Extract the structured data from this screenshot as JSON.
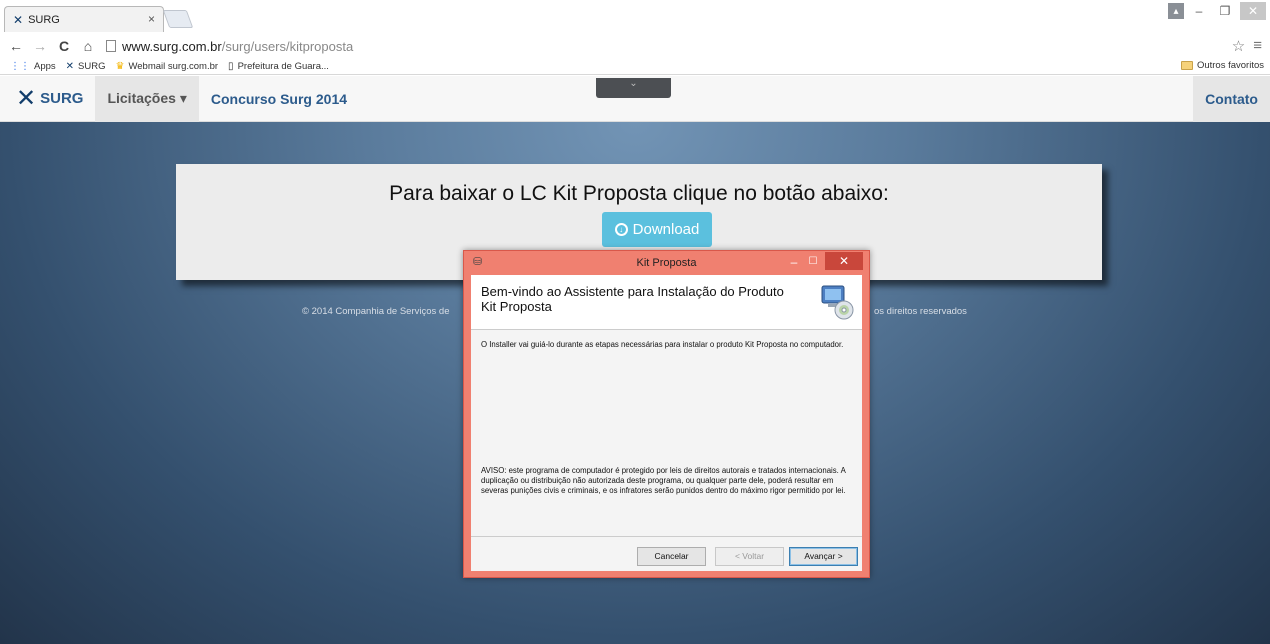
{
  "browser": {
    "tab_title": "SURG",
    "tab_close": "×",
    "url_host": "www.surg.com.br",
    "url_path": "/surg/users/kitproposta",
    "bookmarks": [
      {
        "label": "Apps"
      },
      {
        "label": "SURG"
      },
      {
        "label": "Webmail surg.com.br"
      },
      {
        "label": "Prefeitura de Guara..."
      }
    ],
    "other_bookmarks": "Outros favoritos"
  },
  "site": {
    "brand": "SURG",
    "nav_licitacoes": "Licitações ▾",
    "nav_concurso": "Concurso Surg 2014",
    "nav_contato": "Contato"
  },
  "main": {
    "heading": "Para baixar o LC Kit Proposta clique no botão abaixo:",
    "download_label": "Download",
    "footer_left": "© 2014 Companhia de Serviços de",
    "footer_right": "os direitos reservados"
  },
  "dialog": {
    "title": "Kit Proposta",
    "header_title": "Bem-vindo ao Assistente para Instalação do Produto Kit Proposta",
    "intro": "O Installer vai guiá-lo durante as etapas necessárias para instalar o produto Kit Proposta no computador.",
    "warning": "AVISO: este programa de computador é protegido por leis de direitos autorais e tratados internacionais. A duplicação ou distribuição não autorizada deste programa, ou qualquer parte dele, poderá resultar em severas punições civis e criminais, e os infratores serão punidos dentro do máximo rigor permitido por lei.",
    "cancel_label": "Cancelar",
    "back_label": "< Voltar",
    "next_label": "Avançar >"
  },
  "colors": {
    "dialog_frame": "#f08070",
    "download_button": "#5bc0de",
    "brand_blue": "#2c5b8c"
  },
  "icons": [
    "surg-logo-icon",
    "back-arrow-icon",
    "forward-arrow-icon",
    "reload-icon",
    "home-icon",
    "star-icon",
    "menu-icon",
    "apps-grid-icon",
    "folder-icon",
    "download-circle-icon",
    "installer-cd-icon"
  ]
}
